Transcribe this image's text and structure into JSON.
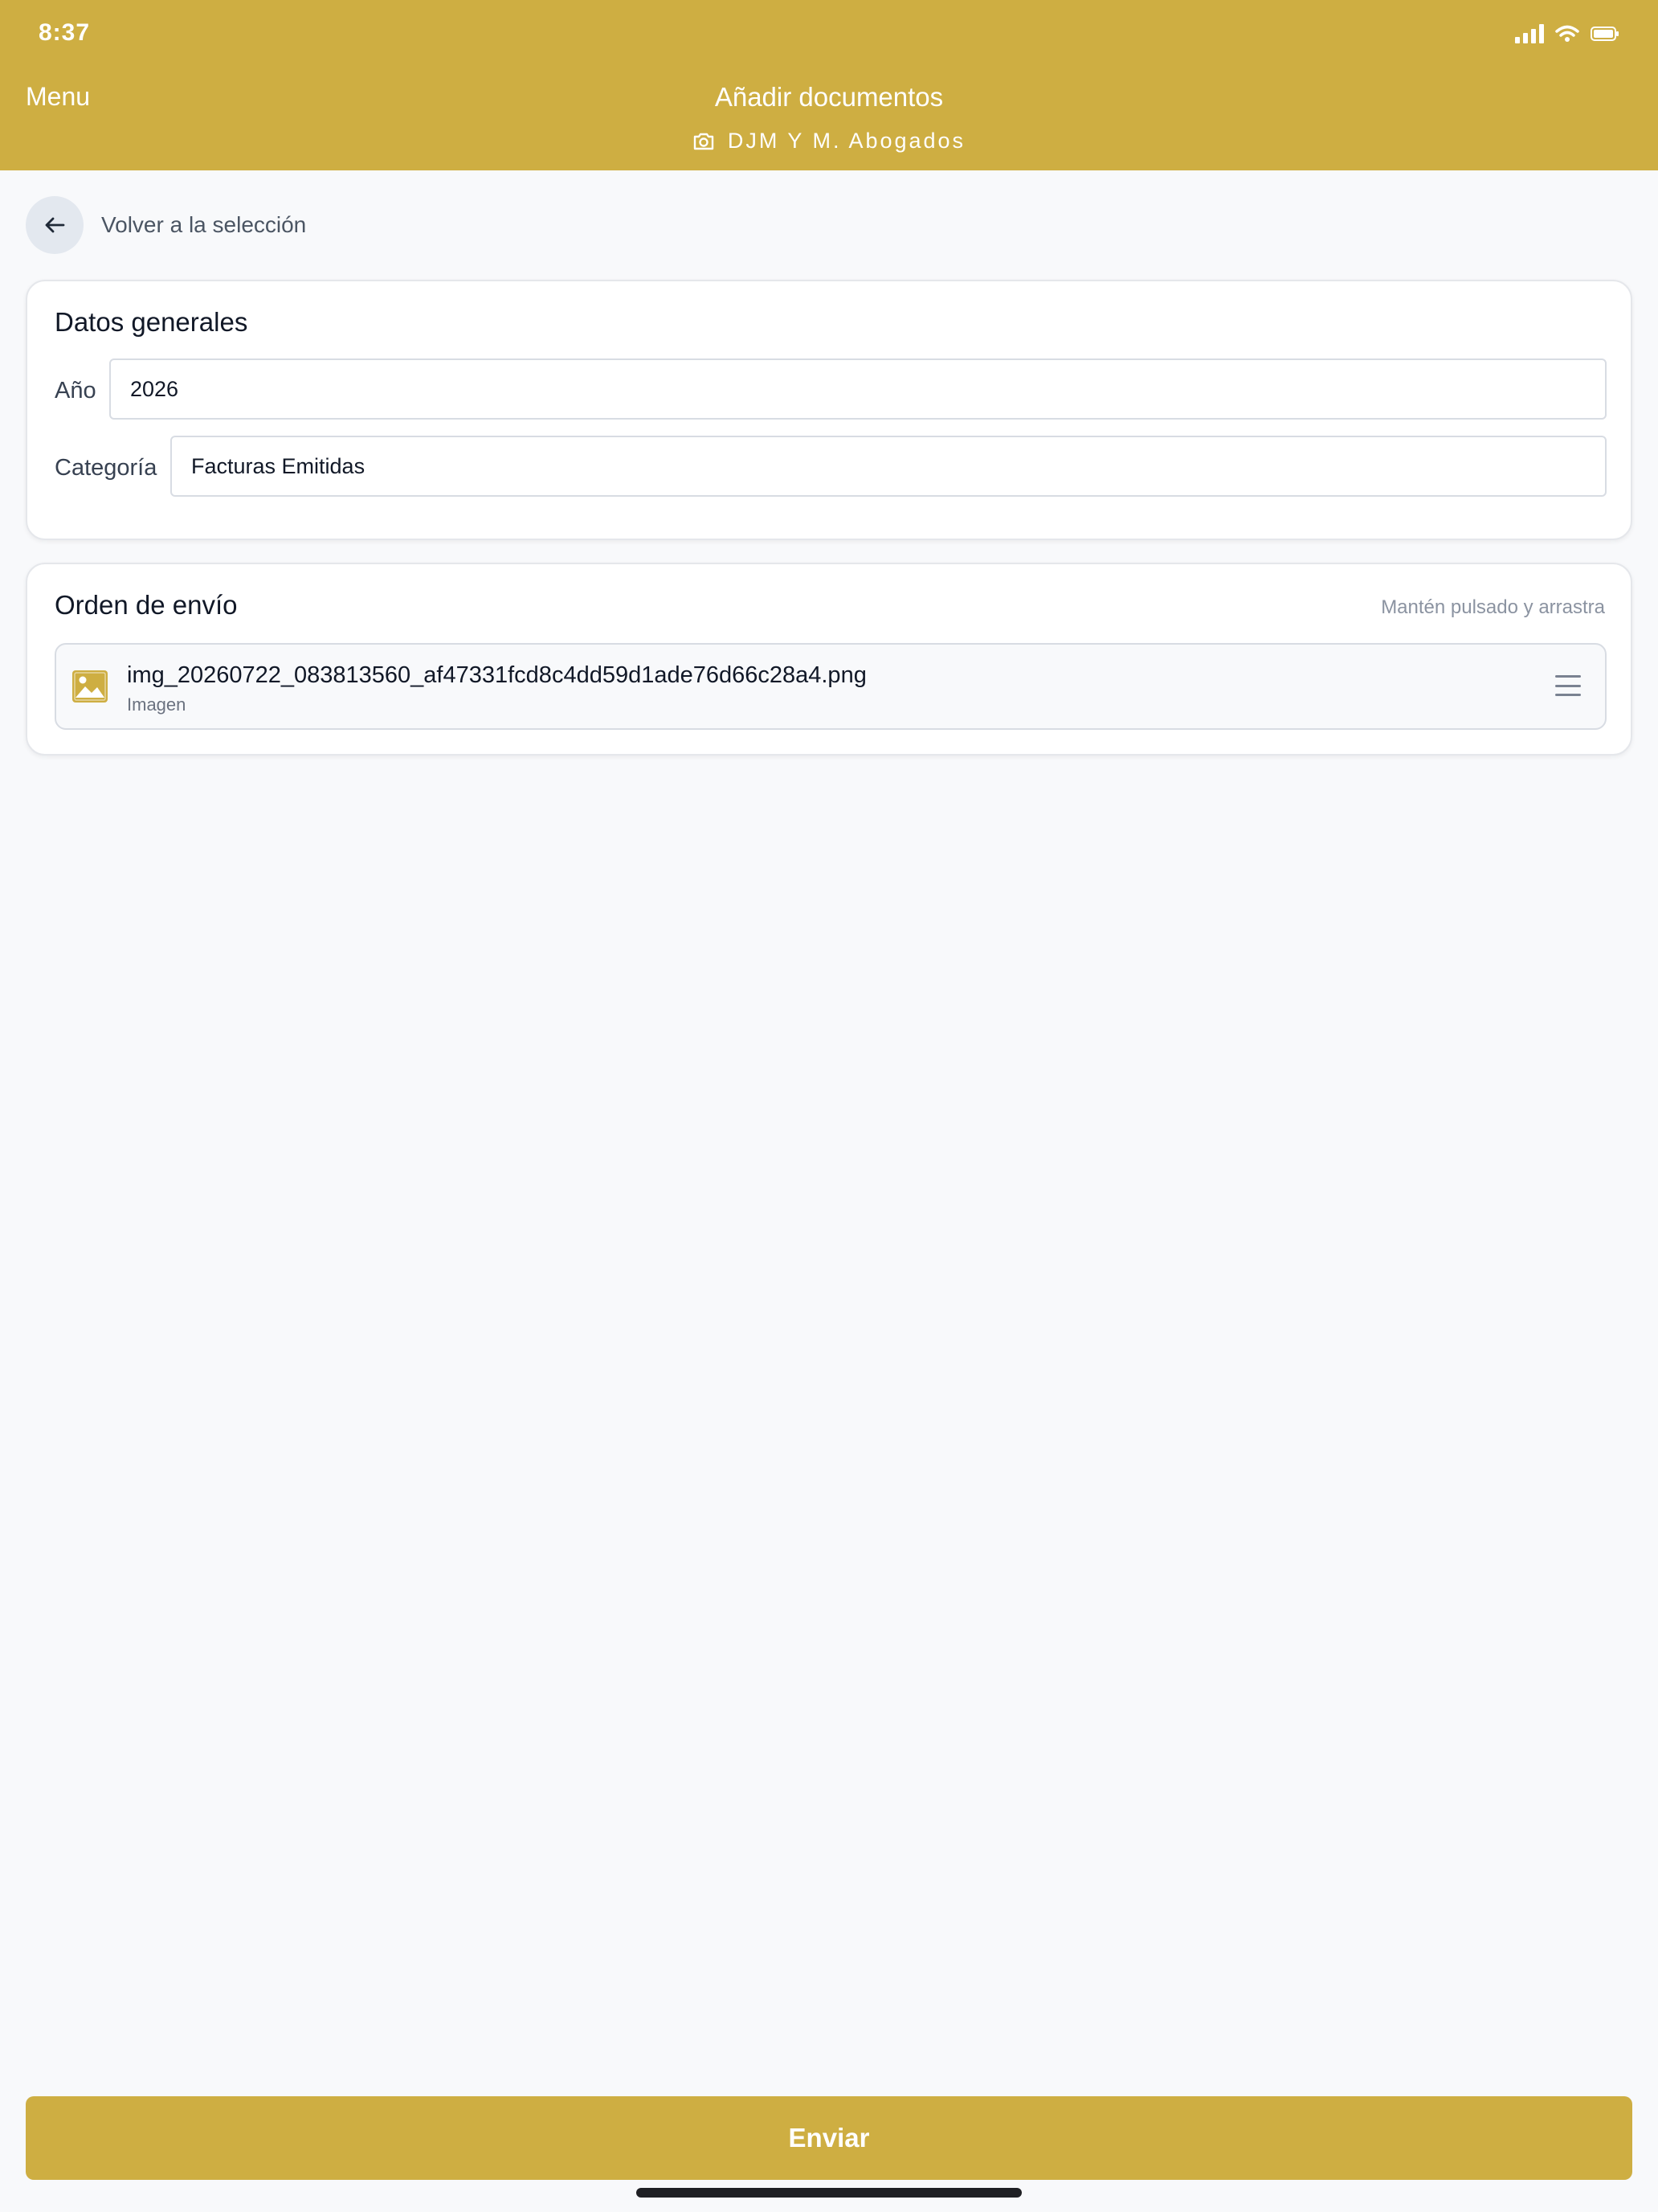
{
  "status_bar": {
    "time": "8:37",
    "icons": [
      "signal-icon",
      "wifi-icon",
      "battery-icon"
    ]
  },
  "header": {
    "menu_label": "Menu",
    "title": "Añadir documentos",
    "subtitle_icon": "camera-icon",
    "subtitle": "DJM Y M. Abogados"
  },
  "back": {
    "icon": "arrow-left-icon",
    "label": "Volver a la selección"
  },
  "general": {
    "title": "Datos generales",
    "year_label": "Año",
    "year_value": "2026",
    "category_label": "Categoría",
    "category_value": "Facturas Emitidas"
  },
  "order": {
    "title": "Orden de envío",
    "hint": "Mantén pulsado y arrastra",
    "files": [
      {
        "icon": "image-icon",
        "name": "img_20260722_083813560_af47331fcd8c4dd59d1ade76d66c28a4.png",
        "type": "Imagen",
        "handle_icon": "drag-handle-icon"
      }
    ]
  },
  "submit_label": "Enviar",
  "colors": {
    "brand": "#ceae42",
    "background": "#f8f9fb",
    "card": "#ffffff"
  }
}
